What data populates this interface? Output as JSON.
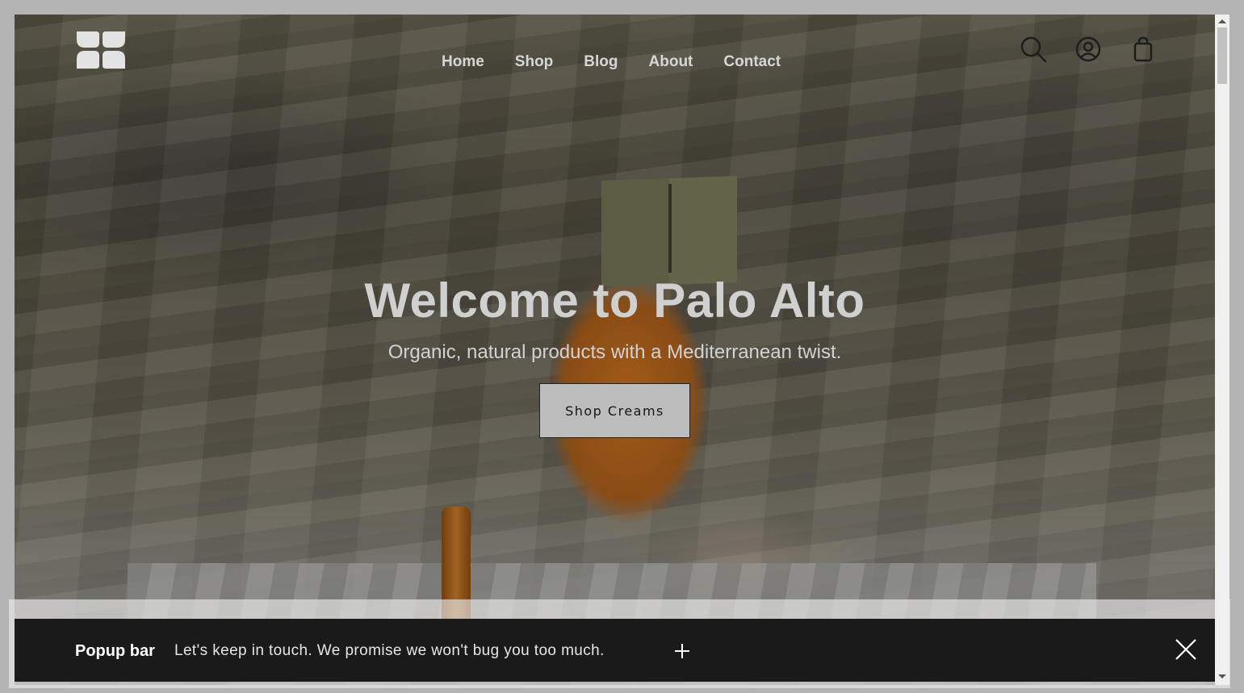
{
  "nav": {
    "items": [
      {
        "label": "Home"
      },
      {
        "label": "Shop"
      },
      {
        "label": "Blog"
      },
      {
        "label": "About"
      },
      {
        "label": "Contact"
      }
    ]
  },
  "header_icons": [
    "search-icon",
    "account-icon",
    "cart-icon"
  ],
  "hero": {
    "title": "Welcome to Palo Alto",
    "subtitle": "Organic, natural products with a Mediterranean twist.",
    "cta_label": "Shop Creams"
  },
  "popup": {
    "title": "Popup bar",
    "message": "Let's keep in touch. We promise we won't bug you too much."
  },
  "colors": {
    "popup_bg": "#1a1a1a",
    "cta_bg": "#bdbdbd",
    "page_frame": "#b4b4b4"
  }
}
